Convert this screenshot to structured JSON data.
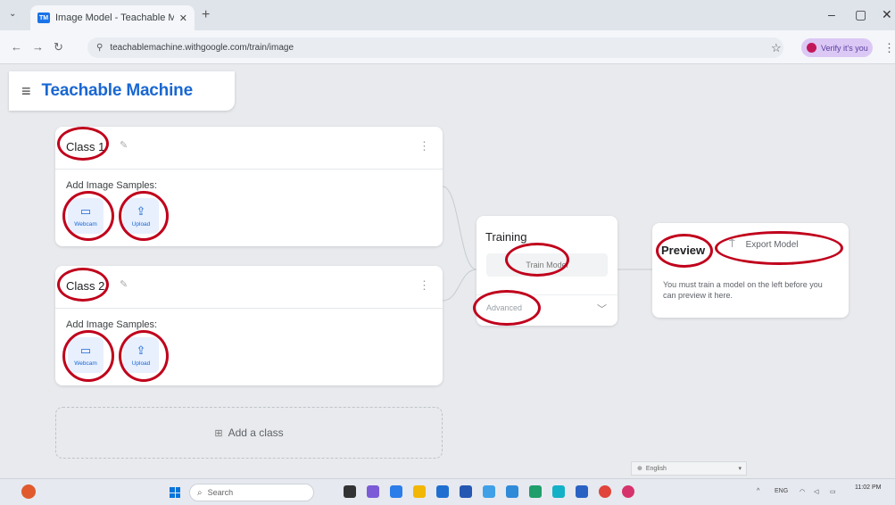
{
  "browser": {
    "tab_title": "Image Model - Teachable Mac",
    "tab_favicon": "TM",
    "url": "teachablemachine.withgoogle.com/train/image",
    "profile_label": "Verify it's you"
  },
  "app": {
    "brand": "Teachable Machine"
  },
  "classes": [
    {
      "name": "Class 1",
      "samples_label": "Add Image Samples:",
      "webcam_label": "Webcam",
      "upload_label": "Upload"
    },
    {
      "name": "Class 2",
      "samples_label": "Add Image Samples:",
      "webcam_label": "Webcam",
      "upload_label": "Upload"
    }
  ],
  "add_class_label": "Add a class",
  "training": {
    "title": "Training",
    "train_button": "Train Model",
    "advanced_label": "Advanced"
  },
  "preview": {
    "title": "Preview",
    "export_button": "Export Model",
    "message": "You must train a model on the left before you can preview it here."
  },
  "language": "English",
  "taskbar": {
    "search_placeholder": "Search",
    "tray_lang": "ENG",
    "clock_time": "11:02 PM"
  },
  "colors": {
    "brand": "#1967d2",
    "annotation_ring": "#c0001b"
  }
}
